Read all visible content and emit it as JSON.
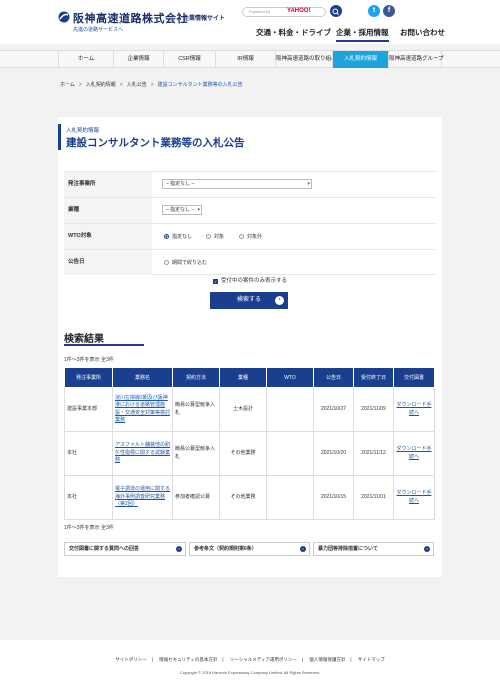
{
  "header": {
    "brand": "阪神高速道路株式会社",
    "brand_sub": "企業情報サイト",
    "tagline": "先進の道路サービスへ",
    "search_powered": "Powered by",
    "search_brand": "YAHOO!",
    "util_nav": [
      "交通・料金・ドライブ",
      "企業・採用情報",
      "お問い合わせ"
    ],
    "util_active": "企業・採用情報"
  },
  "gnav": [
    "ホーム",
    "企業情報",
    "CSR情報",
    "IR情報",
    "阪神高速道路の取り組み",
    "入札契約情報",
    "阪神高速道路グループ"
  ],
  "gnav_active": "入札契約情報",
  "breadcrumb": [
    "ホーム",
    "入札契約情報",
    "入札公告",
    "建設コンサルタント業務等の入札公告"
  ],
  "page": {
    "category": "入札契約情報",
    "title": "建設コンサルタント業務等の入札公告"
  },
  "form": {
    "office_label": "発注事業所",
    "office_value": "– 指定なし –",
    "industry_label": "業種",
    "industry_value": "– 指定なし –",
    "wto_label": "WTO対象",
    "wto_options": [
      "指定なし",
      "対象",
      "対象外"
    ],
    "wto_selected": "指定なし",
    "date_label": "公告日",
    "date_option": "期間で絞り込む",
    "checkbox_label": "受付中の案件のみ表示する",
    "checkbox_checked": true,
    "submit_label": "検索する"
  },
  "results": {
    "title": "検索結果",
    "count_text": "1件～3件を表示 全3件",
    "columns": [
      "発注事業所",
      "業務名",
      "契約方法",
      "業種",
      "WTO",
      "公告日",
      "受付終了日",
      "交付図書"
    ],
    "rows": [
      {
        "office": "建設事業本部",
        "name": "淀川左岸線2期及び阪神港における道路管理施設・交通安全対策等検討業務",
        "method": "簡易公募型競争入札",
        "type": "土木設計",
        "wto": "",
        "date": "2021/10/27",
        "end": "2021/11/09",
        "doc": "ダウンロード手続へ"
      },
      {
        "office": "本社",
        "name": "アスファルト舗装他の耐久性指標に関する試験業務",
        "method": "簡易公募型競争入札",
        "type": "その他業務",
        "wto": "",
        "date": "2021/10/20",
        "end": "2021/11/12",
        "doc": "ダウンロード手続へ"
      },
      {
        "office": "本社",
        "name": "電子調達の運用に関する海外事例調査研究業務（第2回）",
        "method": "参加者確認公募",
        "type": "その他業務",
        "wto": "",
        "date": "2021/10/15",
        "end": "2021/11/01",
        "doc": "ダウンロード手続へ"
      }
    ]
  },
  "links": [
    "交付図書に関する質問への回答",
    "参考条文（契約規則第6条）",
    "暴力団等排除措置について"
  ],
  "footer": {
    "links": [
      "サイトポリシー",
      "情報セキュリティの基本方針",
      "ソーシャルメディア運用ポリシー",
      "個人情報保護方針",
      "サイトマップ"
    ],
    "copyright": "Copyright © 2018 Hanshin Expressway Company Limited. All Rights Reserved."
  }
}
